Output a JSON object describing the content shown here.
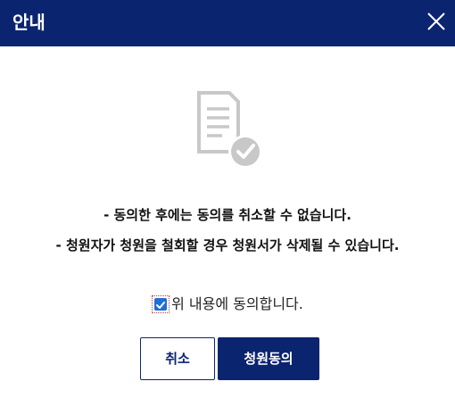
{
  "dialog": {
    "title": "안내",
    "close_icon": "close-icon"
  },
  "illustration": {
    "icon": "document-check-icon"
  },
  "messages": [
    "- 동의한 후에는 동의를 취소할 수 없습니다.",
    "- 청원자가 청원을 철회할 경우 청원서가 삭제될 수 있습니다."
  ],
  "agreement": {
    "checked": true,
    "label": "위 내용에 동의합니다."
  },
  "buttons": {
    "cancel_label": "취소",
    "agree_label": "청원동의"
  },
  "colors": {
    "brand": "#0b2470",
    "checkbox": "#1f6fd6",
    "icon_gray": "#c8c8c8"
  }
}
